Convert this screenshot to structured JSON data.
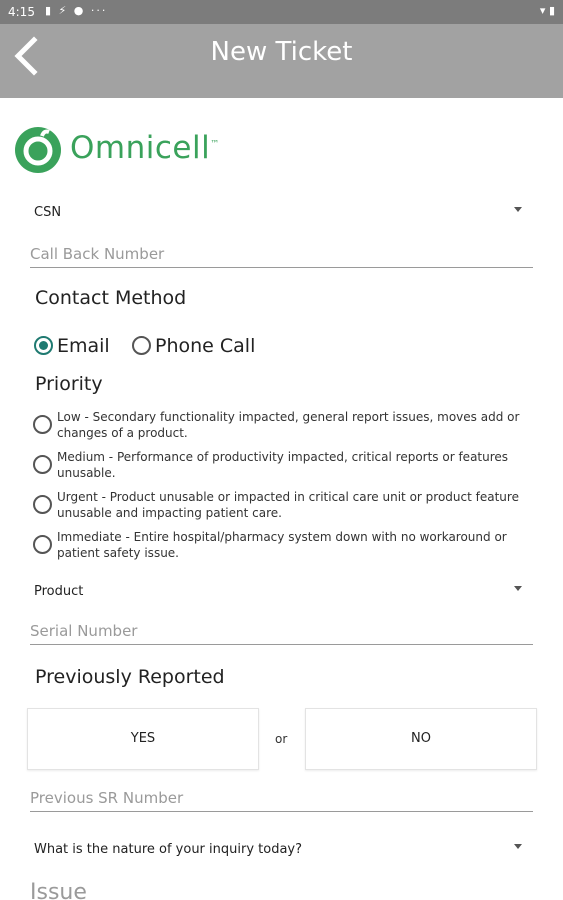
{
  "status_bar": {
    "time": "4:15",
    "left_icons": "▮ ⚡ ● ···",
    "right_icons": "▾ ▮"
  },
  "app_bar": {
    "title": "New Ticket",
    "back_icon": "chevron-left-icon"
  },
  "brand": {
    "name": "Omnicell",
    "tm": "™",
    "color": "#3aa25b"
  },
  "form": {
    "csn_select": {
      "value": "CSN"
    },
    "call_back": {
      "placeholder": "Call Back Number"
    },
    "contact_method": {
      "label": "Contact Method",
      "options": [
        {
          "label": "Email",
          "selected": true
        },
        {
          "label": "Phone Call",
          "selected": false
        }
      ]
    },
    "priority": {
      "label": "Priority",
      "options": [
        {
          "label": "Low - Secondary functionality impacted, general report issues, moves add or changes of a product.",
          "selected": false
        },
        {
          "label": "Medium - Performance of productivity impacted, critical reports or features unusable.",
          "selected": false
        },
        {
          "label": "Urgent - Product unusable or impacted in critical care unit or product feature unusable and impacting patient care.",
          "selected": false
        },
        {
          "label": "Immediate - Entire hospital/pharmacy system down with no workaround or patient safety issue.",
          "selected": false
        }
      ]
    },
    "product_select": {
      "value": "Product"
    },
    "serial_number": {
      "placeholder": "Serial Number"
    },
    "previously_reported": {
      "label": "Previously Reported",
      "yes": "YES",
      "or": "or",
      "no": "NO"
    },
    "previous_sr": {
      "placeholder": "Previous SR Number"
    },
    "inquiry_select": {
      "value": "What is the nature of your inquiry today?"
    },
    "issue": {
      "placeholder": "Issue"
    }
  },
  "colors": {
    "accent": "#1f7a71",
    "app_bar": "#a2a2a2",
    "status_bar": "#7c7c7c"
  }
}
